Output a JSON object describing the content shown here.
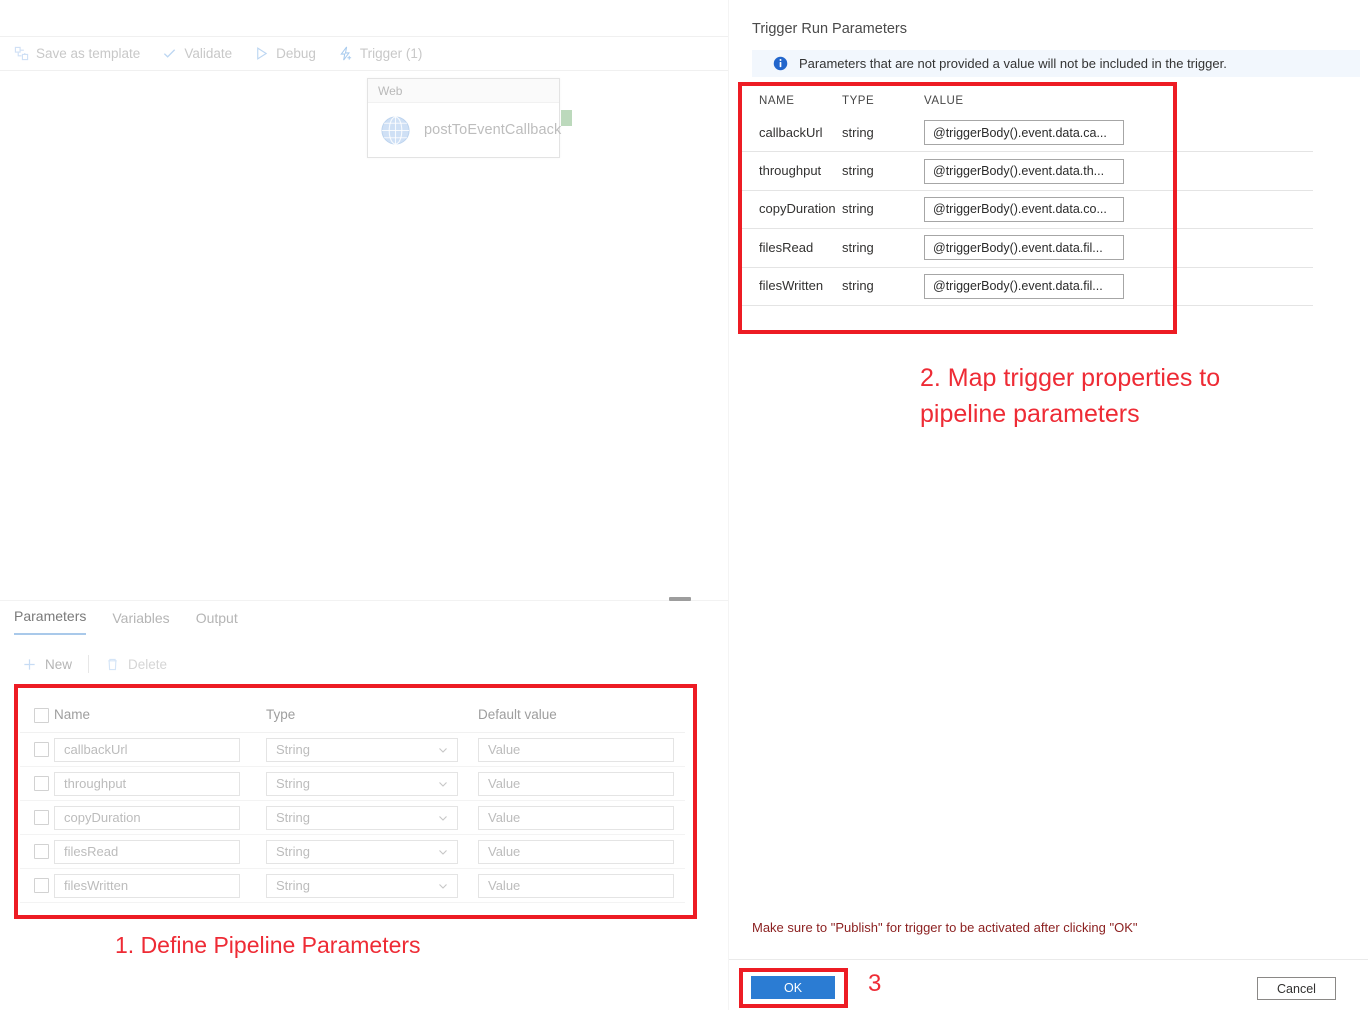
{
  "pipeline": {
    "toolbar": [
      {
        "label": "Save as template",
        "icon": "save-as-template-icon"
      },
      {
        "label": "Validate",
        "icon": "checkmark-icon"
      },
      {
        "label": "Debug",
        "icon": "play-icon"
      },
      {
        "label": "Trigger (1)",
        "icon": "lightning-bolt-icon"
      }
    ],
    "activity": {
      "type_label": "Web",
      "name": "postToEventCallback",
      "icon": "globe-icon"
    }
  },
  "bottom_panel": {
    "tabs": [
      {
        "label": "Parameters",
        "active": true
      },
      {
        "label": "Variables",
        "active": false
      },
      {
        "label": "Output",
        "active": false
      }
    ],
    "actions": [
      {
        "label": "New",
        "icon": "plus-icon"
      },
      {
        "label": "Delete",
        "icon": "trash-icon"
      }
    ],
    "grid": {
      "headers": [
        "Name",
        "Type",
        "Default value"
      ],
      "rows": [
        {
          "name": "callbackUrl",
          "type": "String",
          "default_value": "Value"
        },
        {
          "name": "throughput",
          "type": "String",
          "default_value": "Value"
        },
        {
          "name": "copyDuration",
          "type": "String",
          "default_value": "Value"
        },
        {
          "name": "filesRead",
          "type": "String",
          "default_value": "Value"
        },
        {
          "name": "filesWritten",
          "type": "String",
          "default_value": "Value"
        }
      ]
    }
  },
  "trigger_panel": {
    "title": "Trigger Run Parameters",
    "info_message": "Parameters that are not provided a value will not be included in the trigger.",
    "table": {
      "headers": [
        "NAME",
        "TYPE",
        "VALUE"
      ],
      "rows": [
        {
          "name": "callbackUrl",
          "type": "string",
          "value": "@triggerBody().event.data.ca..."
        },
        {
          "name": "throughput",
          "type": "string",
          "value": "@triggerBody().event.data.th..."
        },
        {
          "name": "copyDuration",
          "type": "string",
          "value": "@triggerBody().event.data.co..."
        },
        {
          "name": "filesRead",
          "type": "string",
          "value": "@triggerBody().event.data.fil..."
        },
        {
          "name": "filesWritten",
          "type": "string",
          "value": "@triggerBody().event.data.fil..."
        }
      ]
    },
    "publish_note": "Make sure to \"Publish\" for trigger to be activated after clicking \"OK\"",
    "ok_label": "OK",
    "cancel_label": "Cancel"
  },
  "annotations": {
    "step1": "1. Define Pipeline Parameters",
    "step2_line1": "2. Map trigger properties to",
    "step2_line2": "pipeline parameters",
    "step3": "3",
    "highlight_color": "#ed1c24"
  }
}
